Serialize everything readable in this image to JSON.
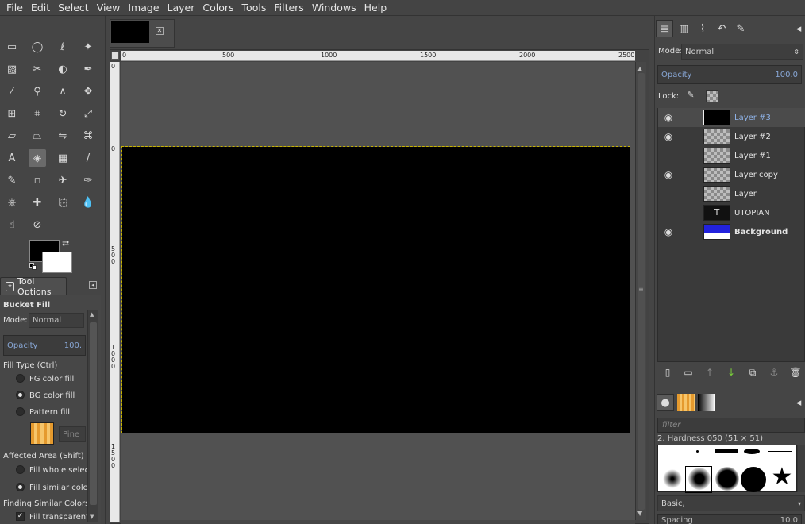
{
  "menubar": [
    "File",
    "Edit",
    "Select",
    "View",
    "Image",
    "Layer",
    "Colors",
    "Tools",
    "Filters",
    "Windows",
    "Help"
  ],
  "menubar_mnemonics": [
    "F",
    "E",
    "S",
    "V",
    "I",
    "L",
    "C",
    "T",
    "r",
    "W",
    "H"
  ],
  "toolbox": {
    "tools": [
      "rect-select-icon",
      "ellipse-select-icon",
      "free-select-icon",
      "fuzzy-select-icon",
      "select-by-color-icon",
      "scissors-icon",
      "foreground-select-icon",
      "paths-icon",
      "color-picker-icon",
      "zoom-icon",
      "measure-icon",
      "move-icon",
      "align-icon",
      "crop-icon",
      "rotate-icon",
      "scale-icon",
      "shear-icon",
      "perspective-icon",
      "flip-icon",
      "cage-icon",
      "text-icon",
      "bucket-fill-icon",
      "blend-icon",
      "pencil-icon",
      "paintbrush-icon",
      "eraser-icon",
      "airbrush-icon",
      "ink-icon",
      "clone-icon",
      "heal-icon",
      "perspective-clone-icon",
      "blur-icon",
      "smudge-icon",
      "dodge-burn-icon"
    ],
    "active_tool": "bucket-fill-icon",
    "fg_color": "#000000",
    "bg_color": "#ffffff"
  },
  "tool_options": {
    "tab_label": "Tool Options",
    "tool_name": "Bucket Fill",
    "mode_label": "Mode:",
    "mode_value": "Normal",
    "opacity_label": "Opacity",
    "opacity_value": "100.",
    "fill_type_label": "Fill Type  (Ctrl)",
    "fill_types": [
      "FG color fill",
      "BG color fill",
      "Pattern fill"
    ],
    "fill_type_selected": 1,
    "pattern_name": "Pine",
    "affected_area_label": "Affected Area  (Shift)",
    "affected_areas": [
      "Fill whole selecti",
      "Fill similar colors"
    ],
    "affected_area_selected": 1,
    "finding_similar_label": "Finding Similar Colors",
    "fill_transparent_label": "Fill transparent a",
    "fill_transparent_checked": true
  },
  "canvas": {
    "ruler_h": [
      "0",
      "500",
      "1000",
      "1500",
      "2000",
      "2500"
    ],
    "ruler_v": [
      "0",
      "0",
      "500",
      "1000",
      "1500"
    ]
  },
  "layers_panel": {
    "mode_label": "Mode:",
    "mode_value": "Normal",
    "opacity_label": "Opacity",
    "opacity_value": "100.0",
    "lock_label": "Lock:",
    "layers": [
      {
        "name": "Layer #3",
        "visible": true,
        "selected": true,
        "thumb": "black"
      },
      {
        "name": "Layer #2",
        "visible": true,
        "selected": false,
        "thumb": "checker"
      },
      {
        "name": "Layer #1",
        "visible": false,
        "selected": false,
        "thumb": "checker"
      },
      {
        "name": "Layer copy",
        "visible": true,
        "selected": false,
        "thumb": "checker"
      },
      {
        "name": "Layer",
        "visible": false,
        "selected": false,
        "thumb": "checker"
      },
      {
        "name": "UTOPIAN",
        "visible": false,
        "selected": false,
        "thumb": "text"
      },
      {
        "name": "Background",
        "visible": true,
        "selected": false,
        "thumb": "blue"
      }
    ],
    "buttons": [
      "new-layer-icon",
      "new-layer-group-icon",
      "raise-layer-icon",
      "lower-layer-icon",
      "duplicate-layer-icon",
      "anchor-layer-icon",
      "delete-layer-icon"
    ]
  },
  "brushes_panel": {
    "filter_placeholder": "filter",
    "selected_brush": "2. Hardness 050 (51 × 51)",
    "tag_value": "Basic,",
    "spacing_label": "Spacing",
    "spacing_value": "10.0"
  }
}
